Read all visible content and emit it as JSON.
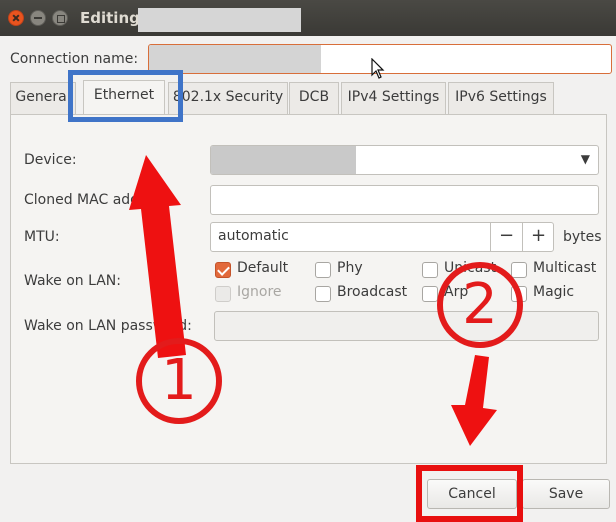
{
  "window": {
    "title": "Editing"
  },
  "connection": {
    "label": "Connection name:",
    "value": ""
  },
  "tabs": [
    {
      "label": "General"
    },
    {
      "label": "Ethernet"
    },
    {
      "label": "802.1x Security"
    },
    {
      "label": "DCB"
    },
    {
      "label": "IPv4 Settings"
    },
    {
      "label": "IPv6 Settings"
    }
  ],
  "ethernet": {
    "device_label": "Device:",
    "cloned_mac_label": "Cloned MAC address:",
    "cloned_mac_value": "",
    "mtu_label": "MTU:",
    "mtu_value": "automatic",
    "mtu_minus": "−",
    "mtu_plus": "+",
    "mtu_unit": "bytes",
    "wol_label": "Wake on LAN:",
    "wol_options": {
      "default": {
        "label": "Default",
        "checked": true
      },
      "phy": {
        "label": "Phy",
        "checked": false
      },
      "unicast": {
        "label": "Unicast",
        "checked": false
      },
      "multicast": {
        "label": "Multicast",
        "checked": false
      },
      "ignore": {
        "label": "Ignore",
        "checked": false,
        "disabled": true
      },
      "broadcast": {
        "label": "Broadcast",
        "checked": false
      },
      "arp": {
        "label": "Arp",
        "checked": false
      },
      "magic": {
        "label": "Magic",
        "checked": false
      }
    },
    "wol_password_label": "Wake on LAN password:",
    "wol_password_value": ""
  },
  "buttons": {
    "cancel": "Cancel",
    "save": "Save"
  },
  "annotations": {
    "step1": "1",
    "step2": "2"
  },
  "colors": {
    "accent": "#e2693b",
    "annotation_red": "#e31b1b",
    "annotation_blue": "#3f74c8"
  }
}
